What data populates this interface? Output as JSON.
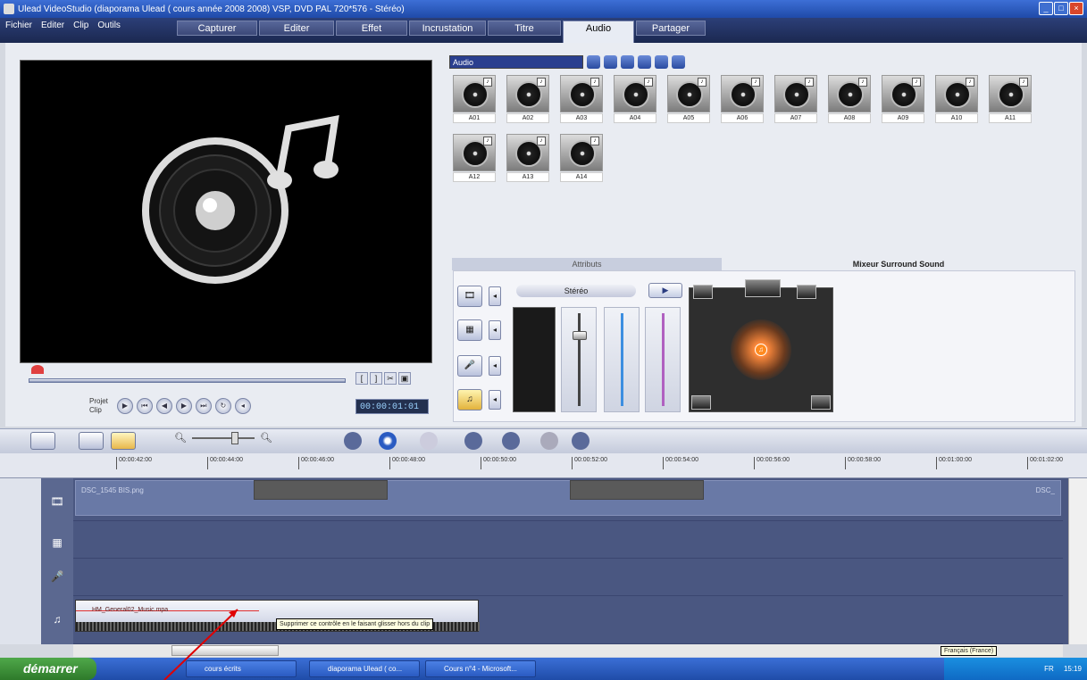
{
  "window": {
    "title": "Ulead VideoStudio (diaporama Ulead ( cours année 2008 2008) VSP, DVD PAL 720*576 - Stéréo)"
  },
  "menus": [
    "Fichier",
    "Editer",
    "Clip",
    "Outils"
  ],
  "steps": [
    {
      "label": "Capturer"
    },
    {
      "label": "Editer"
    },
    {
      "label": "Effet"
    },
    {
      "label": "Incrustation"
    },
    {
      "label": "Titre"
    },
    {
      "label": "Audio"
    },
    {
      "label": "Partager"
    }
  ],
  "preview": {
    "project_label": "Projet",
    "clip_label": "Clip",
    "timecode": "00:00:01:01"
  },
  "library": {
    "category": "Audio",
    "clips": [
      "A01",
      "A02",
      "A03",
      "A04",
      "A05",
      "A06",
      "A07",
      "A08",
      "A09",
      "A10",
      "A11",
      "A12",
      "A13",
      "A14"
    ]
  },
  "options": {
    "tabs": [
      "Attributs",
      "Mixeur Surround Sound"
    ],
    "stereo_label": "Stéréo"
  },
  "ruler": {
    "ticks": [
      "00:00:42:00",
      "00:00:44:00",
      "00:00:46:00",
      "00:00:48:00",
      "00:00:50:00",
      "00:00:52:00",
      "00:00:54:00",
      "00:00:56:00",
      "00:00:58:00",
      "00:01:00:00",
      "00:01:02:00"
    ]
  },
  "timeline": {
    "video_clip": "DSC_1545 BIS.png",
    "video_clip_end": "DSC_",
    "audio_clip": "HM_General02_Music.mpa",
    "tooltip": "Supprimer ce contrôle en le faisant glisser hors du clip"
  },
  "taskbar": {
    "start": "démarrer",
    "tasks": [
      "cours écrits",
      "diaporama Ulead ( co...",
      "Cours n°4 - Microsoft..."
    ],
    "tray_time": "15:19",
    "tray_lang": "FR",
    "lang_tooltip": "Français (France)"
  },
  "colors": {
    "title": "#1f4aa8",
    "tab_active": "#e8ecf4",
    "timeline_bg": "#4a5781",
    "arrow": "#e00000"
  }
}
